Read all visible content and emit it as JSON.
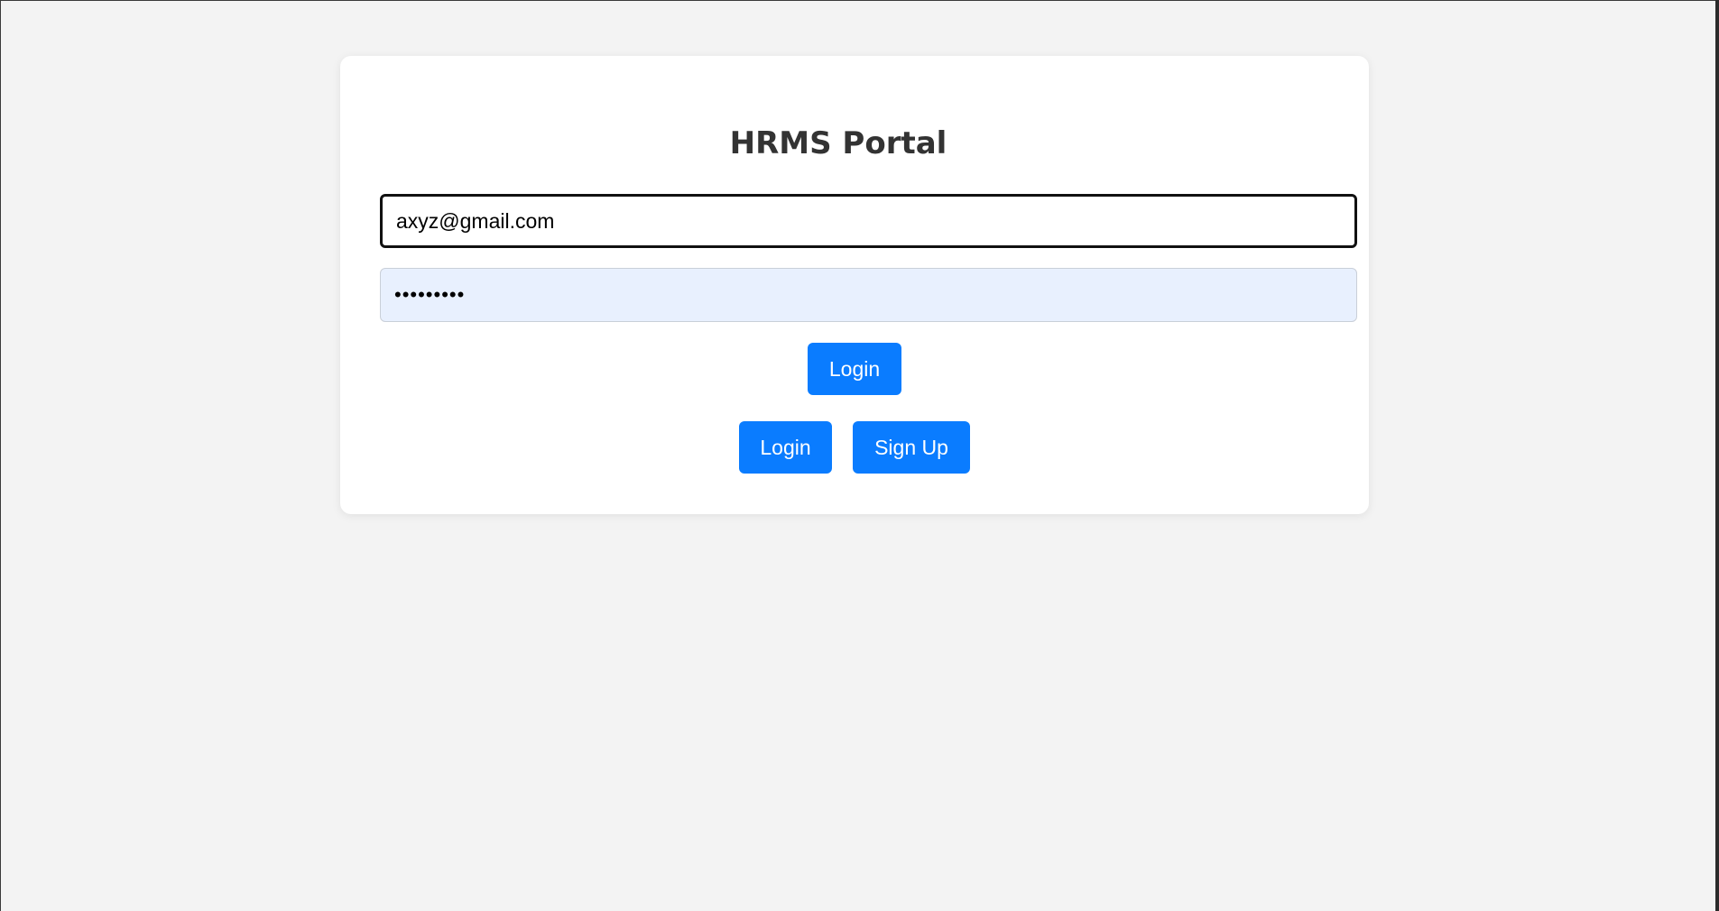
{
  "page": {
    "title": "HRMS Portal"
  },
  "form": {
    "email_value": "axyz@gmail.com",
    "password_value": "•••••••••",
    "login_label": "Login"
  },
  "actions": {
    "login_label": "Login",
    "signup_label": "Sign Up"
  },
  "colors": {
    "background": "#f3f3f3",
    "card": "#ffffff",
    "primary": "#0a7cff",
    "autofill": "#e8f0fe"
  }
}
